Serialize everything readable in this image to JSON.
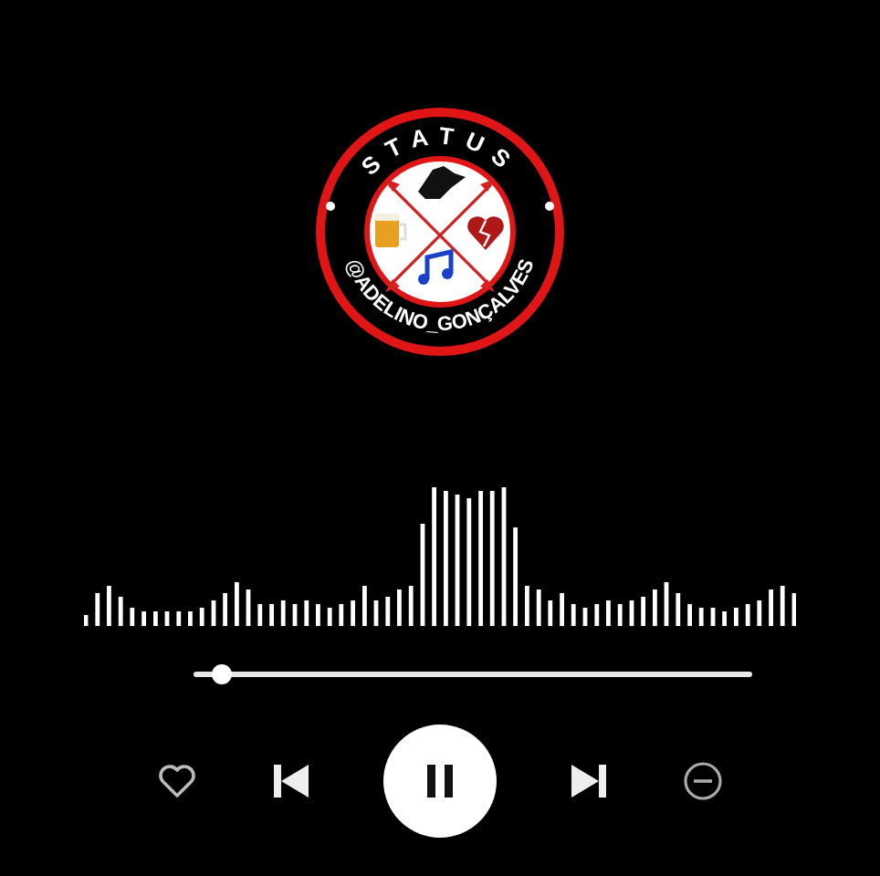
{
  "logo": {
    "top_text": "STATUS",
    "bottom_text": "@ADELINO_GONÇALVES"
  },
  "progress": {
    "level": 0.05
  },
  "player": {
    "playing": true,
    "liked": false
  }
}
